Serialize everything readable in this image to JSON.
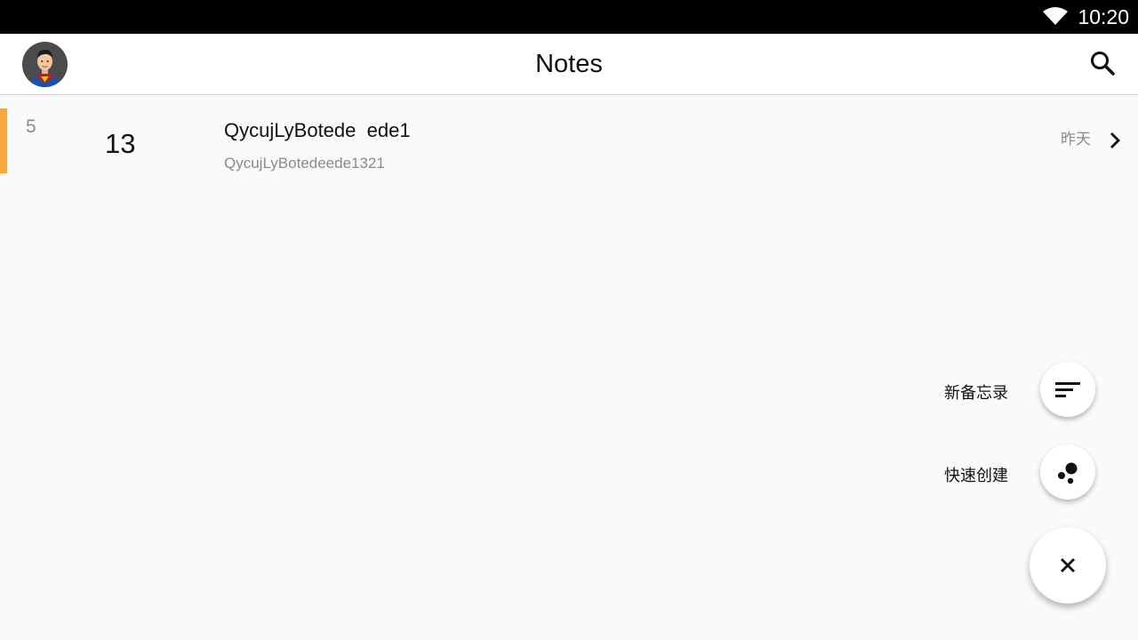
{
  "status_bar": {
    "time": "10:20",
    "wifi_icon": "wifi-icon"
  },
  "app_bar": {
    "title": "Notes",
    "avatar_icon": "superman-avatar",
    "search_icon": "search-icon"
  },
  "notes": [
    {
      "month": "5",
      "day": "13",
      "title": "QycujLyBotede  ede1",
      "preview": "QycujLyBotedeede1321",
      "time": "昨天",
      "accent_color": "#f5a742",
      "chevron_icon": "chevron-right-icon"
    }
  ],
  "fab_menu": {
    "new_note_label": "新备忘录",
    "new_note_icon": "sort-lines-icon",
    "quick_create_label": "快速创建",
    "quick_create_icon": "bubbles-icon",
    "close_icon": "close-icon"
  }
}
